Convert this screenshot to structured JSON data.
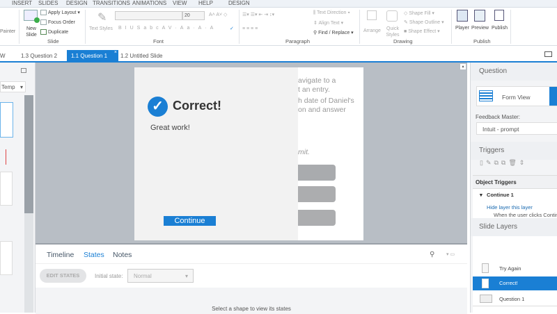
{
  "ribbon_tabs": [
    "INSERT",
    "SLIDES",
    "DESIGN",
    "TRANSITIONS",
    "ANIMATIONS",
    "VIEW",
    "HELP",
    "DESIGN"
  ],
  "ribbon": {
    "painter": "Painter",
    "new_slide": "New Slide",
    "apply_layout": "Apply Layout",
    "focus_order": "Focus Order",
    "duplicate": "Duplicate",
    "group_slide": "Slide",
    "text_styles": "Text Styles",
    "font_size": "20",
    "group_font": "Font",
    "text_direction": "Text Direction",
    "align_text": "Align Text",
    "find_replace": "Find / Replace",
    "group_paragraph": "Paragraph",
    "arrange": "Arrange",
    "quick_styles": "Quick Styles",
    "shape_fill": "Shape Fill",
    "shape_outline": "Shape Outline",
    "shape_effect": "Shape Effect",
    "group_drawing": "Drawing",
    "player": "Player",
    "preview": "Preview",
    "publish": "Publish",
    "group_publish": "Publish"
  },
  "slide_tabs": [
    {
      "label": "W"
    },
    {
      "label": "1.3 Question 2"
    },
    {
      "label": "1.1 Question 1",
      "active": true
    },
    {
      "label": "1.2 Untitled Slide"
    }
  ],
  "left_panel": {
    "dropdown": "Temp"
  },
  "slide": {
    "bg_lines": [
      "avigate to a",
      "t an entry.",
      "h date of Daniel's",
      "on and answer",
      "mit."
    ],
    "title": "Correct!",
    "message": "Great work!",
    "continue": "Continue"
  },
  "bottom": {
    "tabs": [
      "Timeline",
      "States",
      "Notes"
    ],
    "edit_states": "EDIT STATES",
    "initial_state_label": "Initial state:",
    "initial_state_value": "Normal",
    "empty_message": "Select a shape to view its states"
  },
  "right": {
    "question_title": "Question",
    "form_view": "Form View",
    "feedback_master_label": "Feedback Master:",
    "feedback_master_value": "Intuit - prompt",
    "triggers_title": "Triggers",
    "object_triggers": "Object Triggers",
    "trigger_object": "Continue 1",
    "trigger_action": "Hide layer",
    "trigger_target": "this layer",
    "trigger_condition": "When the user clicks Contin",
    "slide_layers_title": "Slide Layers",
    "layers": [
      {
        "name": "Try Again"
      },
      {
        "name": "Correct!",
        "selected": true
      },
      {
        "name": "Question 1"
      }
    ]
  },
  "colors": {
    "accent": "#1a7fd4",
    "canvas": "#b8bec5"
  }
}
